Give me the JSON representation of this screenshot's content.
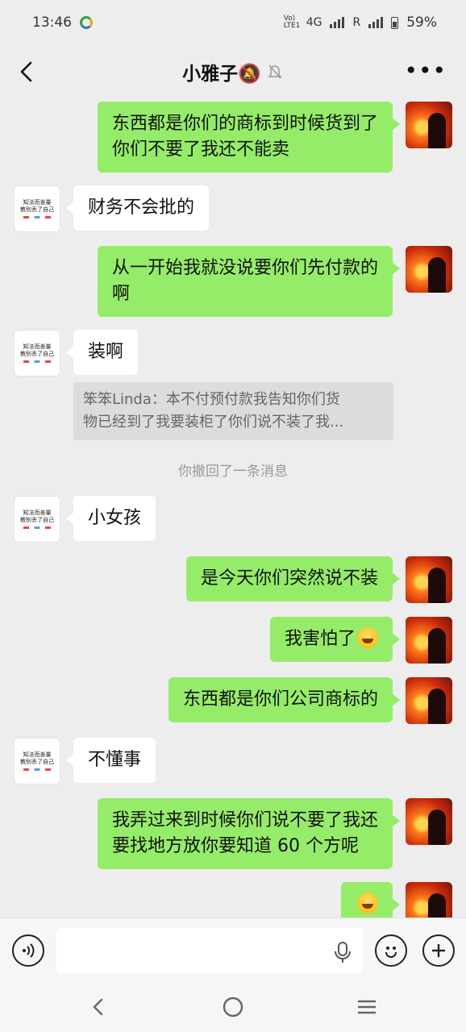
{
  "status_bar": {
    "time": "13:46",
    "volte": "Vo) LTE1",
    "network": "4G",
    "roaming": "R",
    "battery": "59%"
  },
  "header": {
    "title": "小雅子🔕",
    "back_icon": "chevron-left-icon",
    "mute_icon": "bell-off-icon",
    "more_icon": "ellipsis-icon"
  },
  "messages": [
    {
      "from": "me",
      "lines": [
        "东西都是你们的商标到时候货到了",
        "你们不要了我还不能卖"
      ]
    },
    {
      "from": "other",
      "text": "财务不会批的"
    },
    {
      "from": "me",
      "lines": [
        "从一开始我就没说要你们先付款的",
        "啊"
      ]
    },
    {
      "from": "other",
      "text": "装啊"
    },
    {
      "quote": [
        "笨笨Linda：本不付预付款我告知你们货",
        "物已经到了我要装柜了你们说不装了我..."
      ]
    },
    {
      "system": "你撤回了一条消息"
    },
    {
      "from": "other",
      "text": "小女孩"
    },
    {
      "from": "me",
      "text": "是今天你们突然说不装"
    },
    {
      "from": "me",
      "text": "我害怕了",
      "emoji": "laugh-cry-emoji"
    },
    {
      "from": "me",
      "text": "东西都是你们公司商标的"
    },
    {
      "from": "other",
      "text": "不懂事"
    },
    {
      "from": "me",
      "lines": [
        "我弄过来到时候你们说不要了我还",
        "要找地方放你要知道 60 个方呢"
      ]
    },
    {
      "from": "me",
      "emoji": "laugh-cry-emoji"
    }
  ],
  "other_avatar": {
    "line1": "知法而善量",
    "line2": "教别丢了自己"
  },
  "input_bar": {
    "voice_icon": "voice-mode-icon",
    "mic_icon": "microphone-icon",
    "emoji_icon": "emoji-icon",
    "plus_icon": "plus-icon",
    "value": ""
  },
  "nav_bar": {
    "back_icon": "nav-back-icon",
    "home_icon": "nav-home-icon",
    "menu_icon": "nav-recents-icon"
  }
}
